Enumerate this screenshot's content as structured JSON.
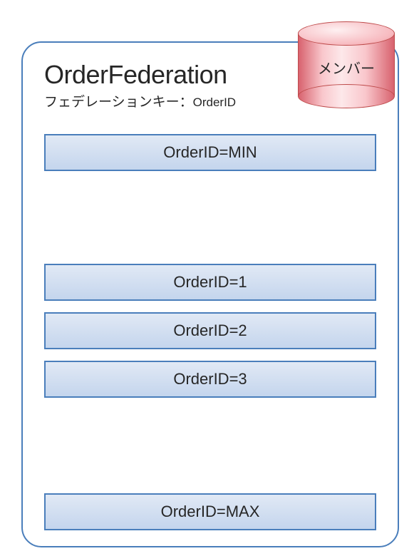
{
  "federation": {
    "title": "OrderFederation",
    "subtitle_prefix": "フェデレーションキー：",
    "subtitle_key": "OrderID"
  },
  "boxes": {
    "min": "OrderID=MIN",
    "b1": "OrderID=1",
    "b2": "OrderID=2",
    "b3": "OrderID=3",
    "max": "OrderID=MAX"
  },
  "cylinder": {
    "label": "メンバー"
  }
}
